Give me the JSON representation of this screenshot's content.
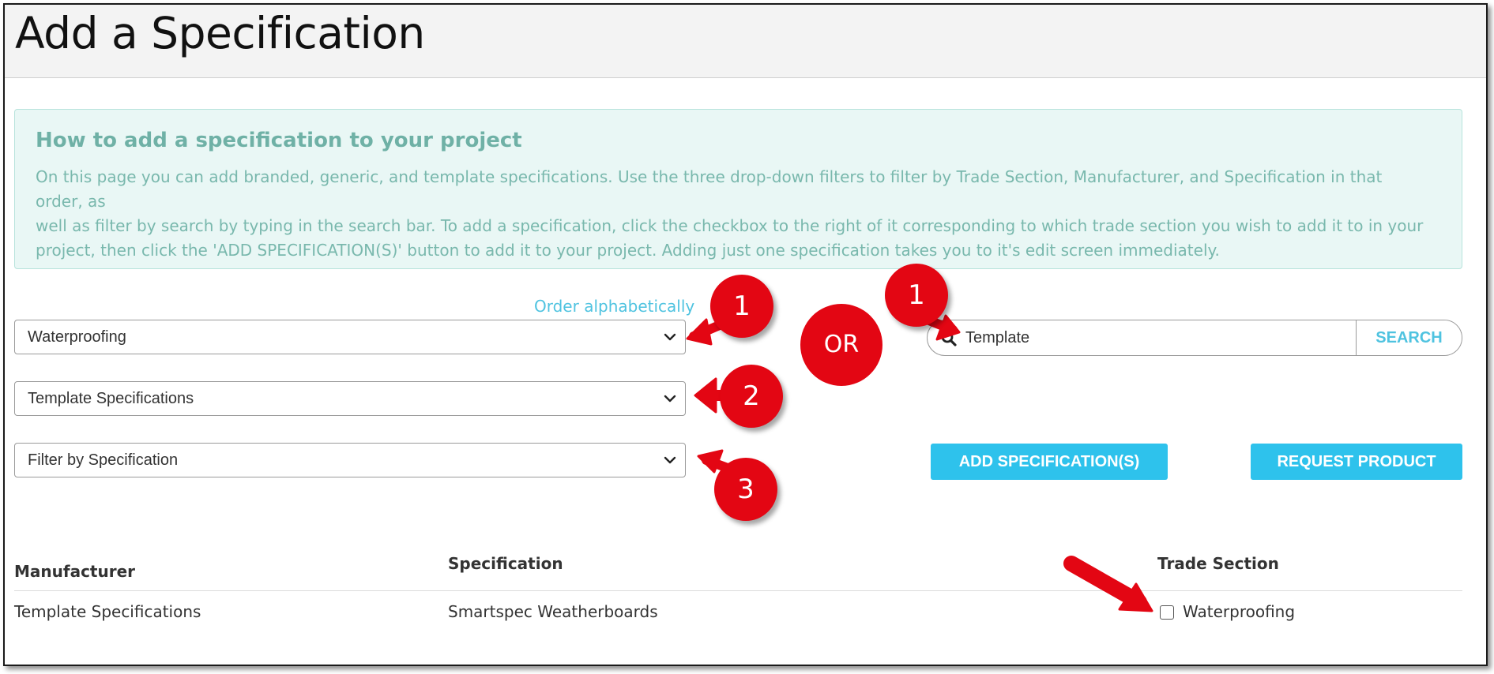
{
  "header": {
    "title": "Add a Specification"
  },
  "info": {
    "title": "How to add a specification to your project",
    "line1": "On this page you can add branded, generic, and template specifications. Use the three drop-down filters to filter by Trade Section, Manufacturer, and Specification in that order, as",
    "line2": "well as filter by search by typing in the search bar. To add a specification, click the checkbox to the right of it corresponding to which trade section you wish to add it to in your",
    "line3": "project, then click the 'ADD SPECIFICATION(S)' button to add it to your project. Adding just one specification takes you to it's edit screen immediately."
  },
  "filters": {
    "order_link": "Order alphabetically",
    "trade_section": "Waterproofing",
    "manufacturer": "Template Specifications",
    "specification": "Filter by Specification"
  },
  "search": {
    "value": "Template",
    "button": "SEARCH"
  },
  "actions": {
    "add": "ADD SPECIFICATION(S)",
    "request": "REQUEST PRODUCT"
  },
  "table": {
    "headers": {
      "manufacturer": "Manufacturer",
      "specification": "Specification",
      "trade_section": "Trade Section"
    },
    "rows": [
      {
        "manufacturer": "Template Specifications",
        "specification": "Smartspec Weatherboards",
        "trade_section": "Waterproofing",
        "checked": false
      }
    ]
  },
  "annotations": {
    "step1": "1",
    "step1b": "1",
    "step2": "2",
    "step3": "3",
    "or": "OR"
  },
  "colors": {
    "accent": "#2ec2ec",
    "annotation_red": "#e30613",
    "info_bg": "#e9f7f5",
    "info_text": "#79b8ad"
  }
}
